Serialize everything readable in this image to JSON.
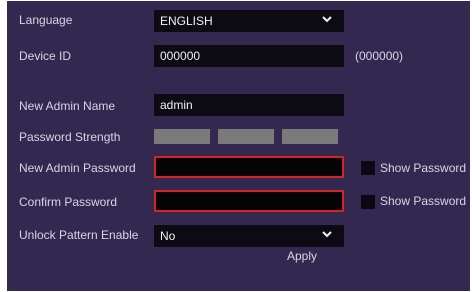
{
  "form": {
    "language": {
      "label": "Language",
      "value": "ENGLISH"
    },
    "device_id": {
      "label": "Device ID",
      "value": "000000",
      "hint": "(000000)"
    },
    "admin_name": {
      "label": "New Admin Name",
      "value": "admin"
    },
    "password_strength": {
      "label": "Password Strength",
      "level": 0,
      "segments": 3
    },
    "new_password": {
      "label": "New Admin Password",
      "value": "",
      "show_label": "Show Password"
    },
    "confirm_password": {
      "label": "Confirm Password",
      "value": "",
      "show_label": "Show Password"
    },
    "unlock_pattern": {
      "label": "Unlock Pattern Enable",
      "value": "No"
    }
  },
  "apply_label": "Apply",
  "colors": {
    "panel": "#33284f",
    "field": "#0c0a12",
    "error_border": "#d42525",
    "strength_empty": "#7a7a7a"
  },
  "icons": {
    "dropdown": "chevron-down-icon"
  }
}
